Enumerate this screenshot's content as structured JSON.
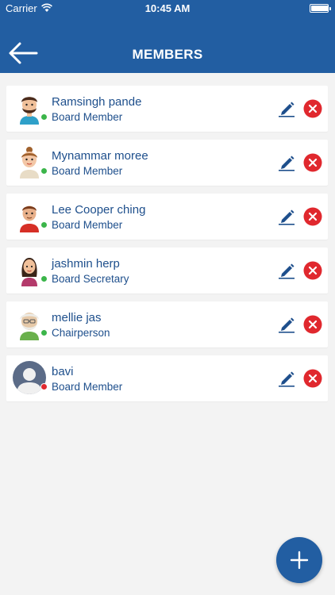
{
  "status_bar": {
    "carrier": "Carrier",
    "time": "10:45 AM",
    "battery_level": 1.0,
    "wifi_icon": "wifi-icon"
  },
  "header": {
    "title": "MEMBERS",
    "back_icon": "arrow-left-icon",
    "background": "#225ea2"
  },
  "colors": {
    "accent": "#225ea2",
    "text": "#1e4f8c",
    "online": "#3bb54a",
    "offline": "#e0282e",
    "delete": "#e0282e"
  },
  "members": [
    {
      "name": "Ramsingh pande",
      "role": "Board Member",
      "status": "online",
      "avatar": "man-beard-avatar"
    },
    {
      "name": "Mynammar moree",
      "role": "Board Member",
      "status": "online",
      "avatar": "woman-bun-avatar"
    },
    {
      "name": "Lee Cooper ching",
      "role": "Board Member",
      "status": "online",
      "avatar": "man-red-shirt-avatar"
    },
    {
      "name": "jashmin herp",
      "role": "Board Secretary",
      "status": "online",
      "avatar": "woman-pink-avatar"
    },
    {
      "name": "mellie jas",
      "role": "Chairperson",
      "status": "online",
      "avatar": "old-man-avatar"
    },
    {
      "name": "bavi",
      "role": "Board Member",
      "status": "offline",
      "avatar": "default-user-avatar"
    }
  ],
  "actions": {
    "edit_icon": "pencil-icon",
    "delete_icon": "close-circle-icon",
    "add_icon": "plus-icon"
  }
}
